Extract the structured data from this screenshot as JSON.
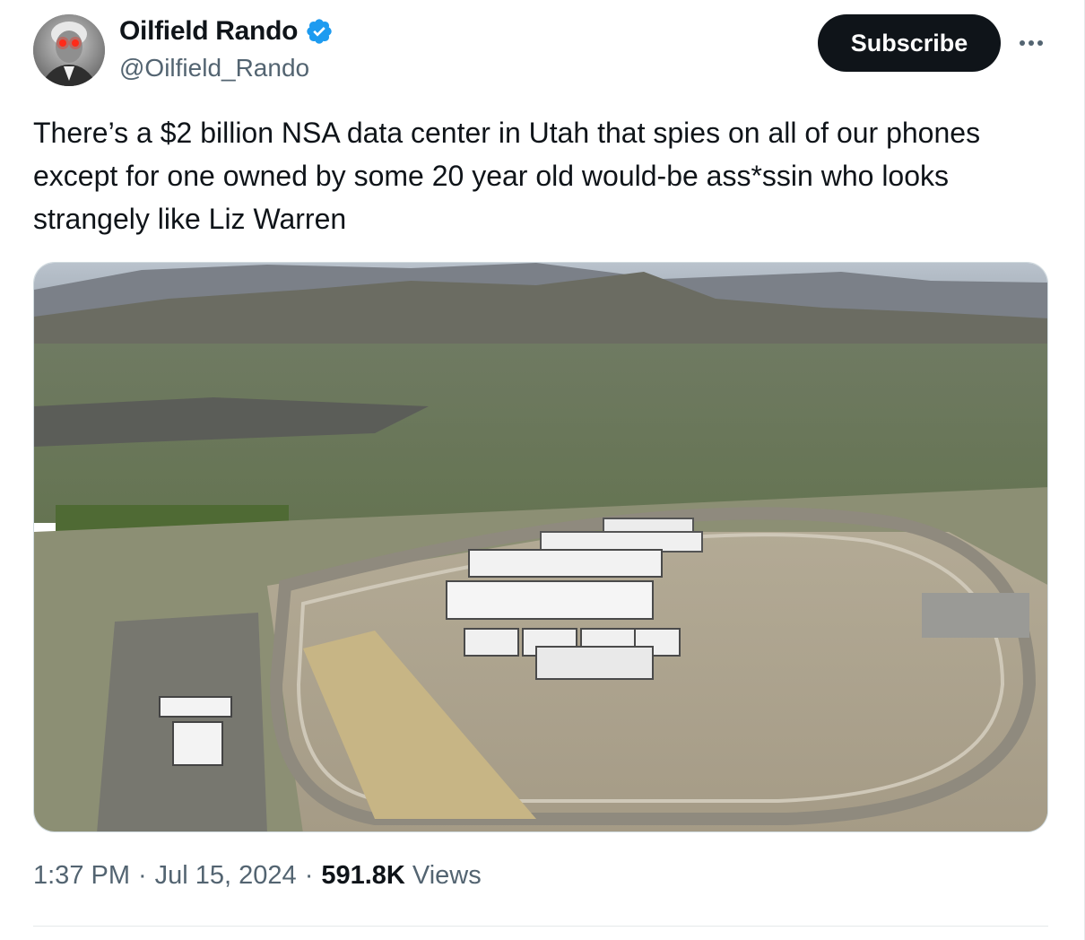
{
  "author": {
    "display_name": "Oilfield Rando",
    "handle": "@Oilfield_Rando",
    "verified": true,
    "verified_color": "#1d9bf0"
  },
  "actions": {
    "subscribe_label": "Subscribe",
    "more_icon": "more-icon"
  },
  "tweet": {
    "text": "There’s a $2 billion NSA data center in Utah that spies on all of our phones except for one owned by some 20 year old would-be ass*ssin who looks strangely like Liz Warren"
  },
  "meta": {
    "time": "1:37 PM",
    "separator": "·",
    "date": "Jul 15, 2024",
    "views_count": "591.8K",
    "views_label": "Views"
  },
  "colors": {
    "text_primary": "#0f1419",
    "text_secondary": "#536471",
    "button_bg": "#0f1419",
    "divider": "#e6e9ea"
  }
}
